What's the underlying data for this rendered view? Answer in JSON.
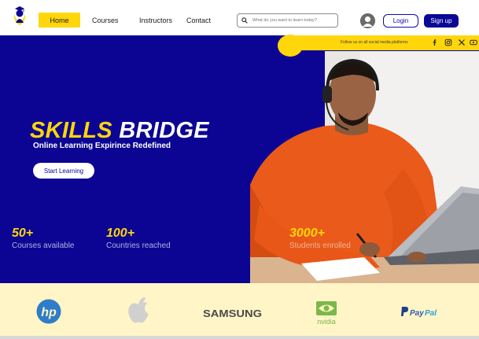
{
  "nav": {
    "items": [
      {
        "label": "Home",
        "active": true
      },
      {
        "label": "Courses"
      },
      {
        "label": "Instructors"
      },
      {
        "label": "Contact"
      }
    ],
    "search_placeholder": "What do you want to learn today?",
    "login_label": "Login",
    "signup_label": "Sign up"
  },
  "social": {
    "text": "Follow us on all social media  platforms",
    "icons": [
      "facebook-icon",
      "instagram-icon",
      "x-icon",
      "youtube-icon"
    ]
  },
  "hero": {
    "title_part1": "SKILLS",
    "title_part2": "BRIDGE",
    "subtitle": "Online Learning Expirince Redefined",
    "cta_label": "Start Learning"
  },
  "stats": [
    {
      "value": "50+",
      "label": "Courses available"
    },
    {
      "value": "100+",
      "label": "Countries reached"
    },
    {
      "value": "3000+",
      "label": "Students enrolled"
    }
  ],
  "partners": [
    "hp",
    "apple",
    "SAMSUNG",
    "nvidia",
    "PayPal"
  ],
  "colors": {
    "primary": "#0c0593",
    "accent": "#ffd60a",
    "partner_bg": "#fff5c6"
  }
}
